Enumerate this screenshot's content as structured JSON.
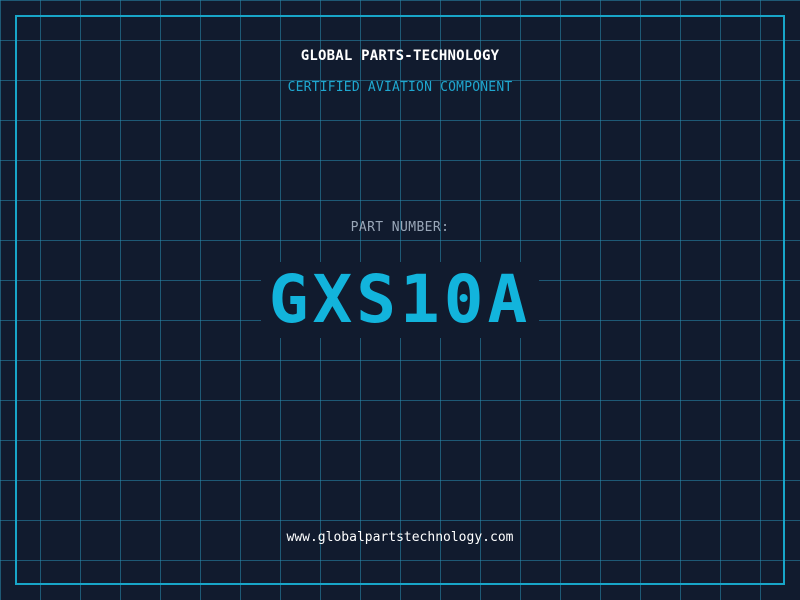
{
  "header": {
    "company": "GLOBAL PARTS-TECHNOLOGY",
    "tagline": "CERTIFIED AVIATION COMPONENT"
  },
  "part": {
    "label": "PART NUMBER:",
    "number": "GXS10A"
  },
  "footer": {
    "website": "www.globalpartstechnology.com"
  },
  "colors": {
    "background": "#111b2e",
    "grid": "#288caf",
    "accent": "#18a5c8",
    "text": "#ffffff",
    "muted": "#9aa7b8"
  }
}
